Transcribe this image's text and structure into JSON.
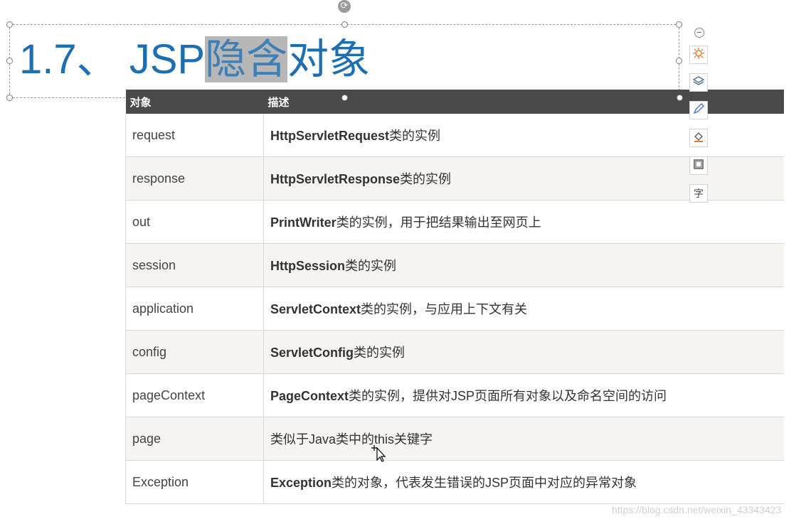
{
  "title": {
    "prefix": "1.7、 JSP",
    "selected": "隐含",
    "suffix": "对象"
  },
  "table": {
    "headers": [
      "对象",
      "描述"
    ],
    "rows": [
      {
        "object": "request",
        "desc_bold": "HttpServletRequest",
        "desc_rest": "类的实例"
      },
      {
        "object": "response",
        "desc_bold": "HttpServletResponse",
        "desc_rest": "类的实例"
      },
      {
        "object": "out",
        "desc_bold": "PrintWriter",
        "desc_rest": "类的实例，用于把结果输出至网页上"
      },
      {
        "object": "session",
        "desc_bold": "HttpSession",
        "desc_rest": "类的实例"
      },
      {
        "object": "application",
        "desc_bold": "ServletContext",
        "desc_rest": "类的实例，与应用上下文有关"
      },
      {
        "object": "config",
        "desc_bold": "ServletConfig",
        "desc_rest": "类的实例"
      },
      {
        "object": "pageContext",
        "desc_bold": "PageContext",
        "desc_rest": "类的实例，提供对JSP页面所有对象以及命名空间的访问"
      },
      {
        "object": "page",
        "desc_bold": "",
        "desc_rest": "类似于Java类中的this关键字"
      },
      {
        "object": "Exception",
        "desc_bold": "Exception",
        "desc_rest": "类的对象，代表发生错误的JSP页面中对应的异常对象"
      }
    ]
  },
  "toolbar": {
    "items": [
      "collapse-icon",
      "animation-icon",
      "layers-icon",
      "pen-icon",
      "fill-icon",
      "border-icon",
      "font-icon"
    ],
    "font_label": "字"
  },
  "watermark": "https://blog.csdn.net/weixin_43343423",
  "colors": {
    "title": "#1b6fb2",
    "header_bg": "#4a4a4a",
    "selection": "#b7b7b7"
  }
}
